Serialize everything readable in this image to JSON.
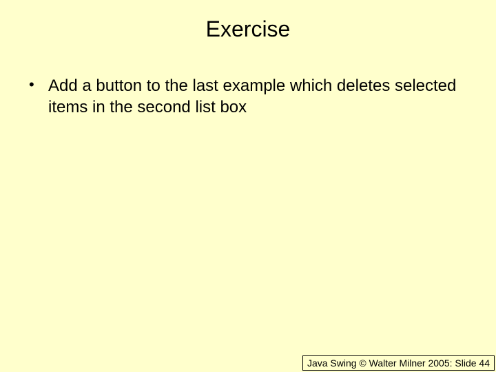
{
  "title": "Exercise",
  "bullets": [
    "Add a button to the last example which deletes selected items in the second list box"
  ],
  "footer": {
    "prefix": "Java Swing © Walter Milner 2005: Slide ",
    "number": "44"
  }
}
